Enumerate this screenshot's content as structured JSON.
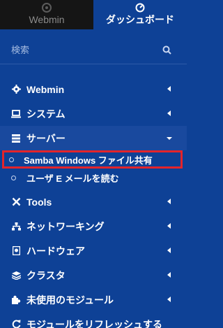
{
  "tabs": {
    "webmin": "Webmin",
    "dashboard": "ダッシュボード"
  },
  "search": {
    "placeholder": "検索"
  },
  "menu": {
    "webmin": "Webmin",
    "system": "システム",
    "servers": "サーバー",
    "servers_sub": [
      "Samba Windows ファイル共有",
      "ユーザ E メールを読む"
    ],
    "tools": "Tools",
    "networking": "ネットワーキング",
    "hardware": "ハードウェア",
    "cluster": "クラスタ",
    "unused": "未使用のモジュール",
    "refresh": "モジュールをリフレッシュする"
  },
  "colors": {
    "sidebar_bg": "#0e4196",
    "tab_dark": "#151515",
    "highlight": "#e3242b"
  }
}
